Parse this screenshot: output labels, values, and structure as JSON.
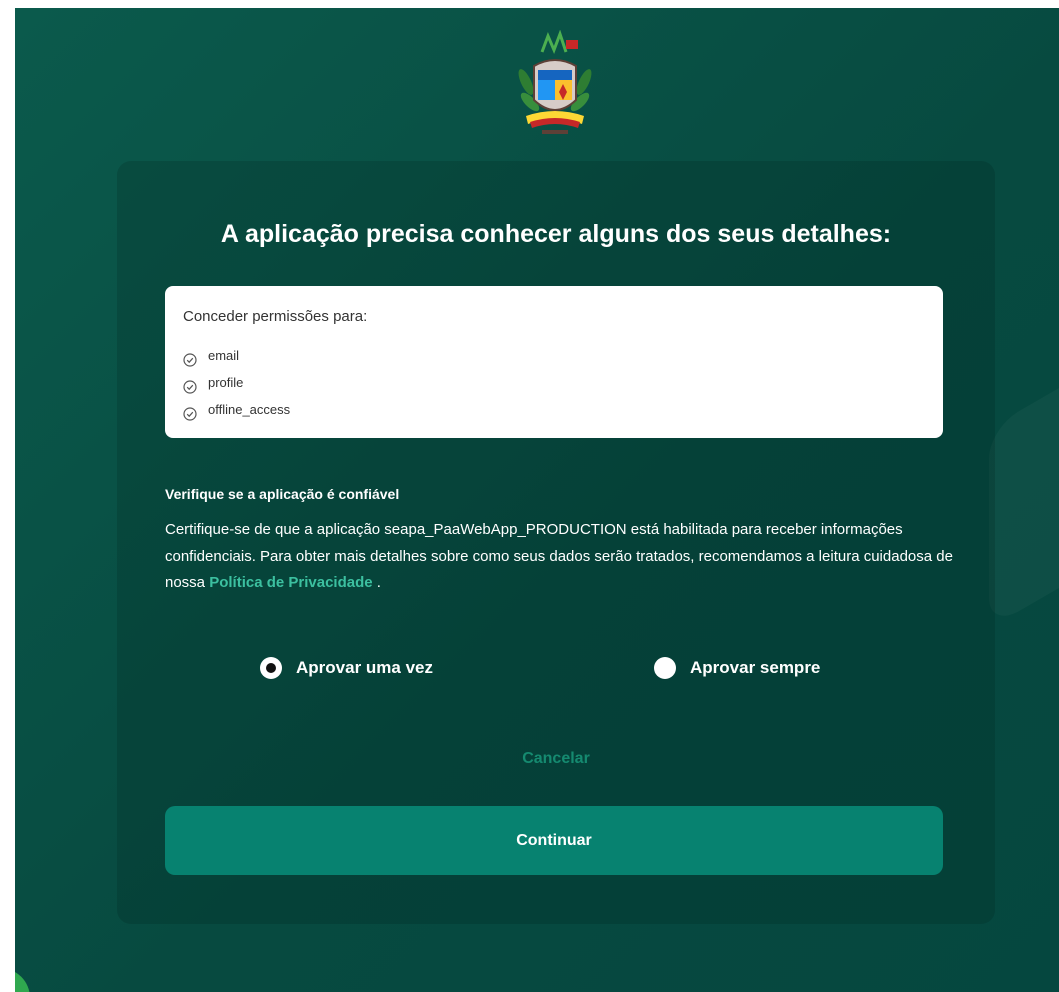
{
  "heading": "A aplicação precisa conhecer alguns dos seus detalhes:",
  "permissions": {
    "title": "Conceder permissões para:",
    "items": [
      "email",
      "profile",
      "offline_access"
    ]
  },
  "verify": {
    "title": "Verifique se a aplicação é confiável",
    "text_before_link": "Certifique-se de que a aplicação seapa_PaaWebApp_PRODUCTION está habilitada para receber informações confidenciais. Para obter mais detalhes sobre como seus dados serão tratados, recomendamos a leitura cuidadosa de nossa ",
    "link_label": "Política de Privacidade",
    "text_after_link": " ."
  },
  "approval": {
    "once_label": "Aprovar uma vez",
    "always_label": "Aprovar sempre",
    "selected": "once"
  },
  "buttons": {
    "cancel_label": "Cancelar",
    "continue_label": "Continuar"
  },
  "icons": {
    "logo": "coat-of-arms-icon",
    "permission": "check-circle-icon"
  },
  "colors": {
    "background": "#0b5a4c",
    "accent": "#078270",
    "link": "#3cc0a0"
  }
}
